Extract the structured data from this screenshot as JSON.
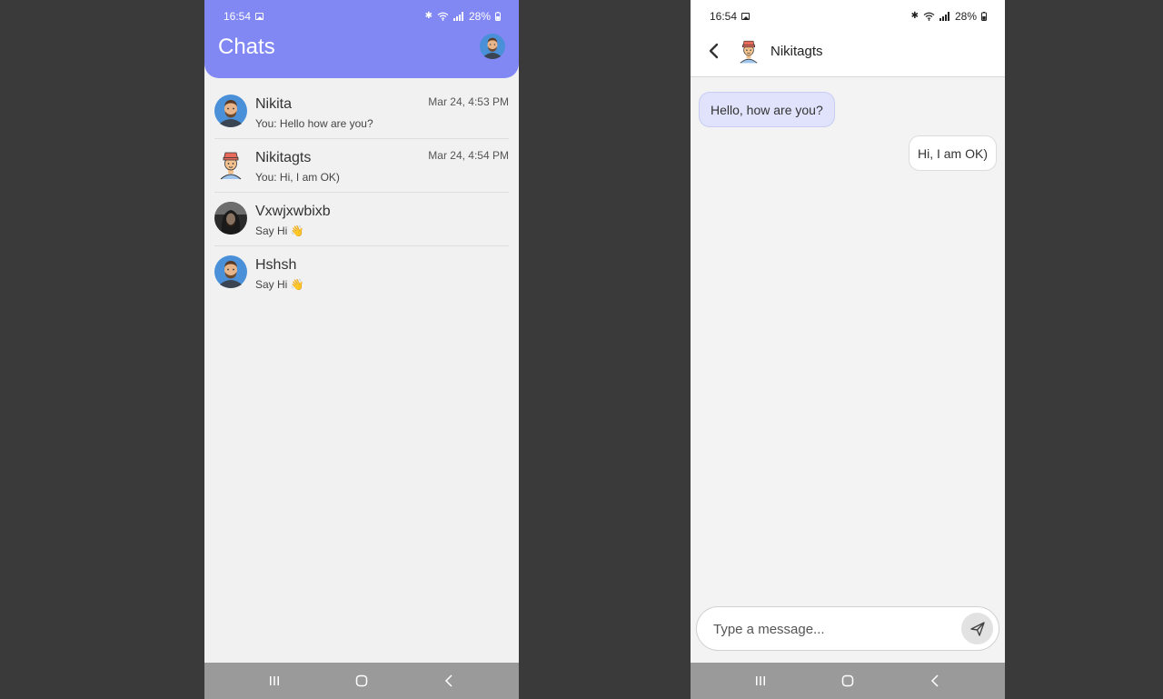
{
  "status_bar": {
    "time": "16:54",
    "battery": "28%"
  },
  "chats_screen": {
    "title": "Chats",
    "chats": [
      {
        "name": "Nikita",
        "preview": "You: Hello how are you?",
        "time": "Mar 24, 4:53 PM",
        "avatar": "man-avatar-icon"
      },
      {
        "name": "Nikitagts",
        "preview": "You: Hi, I am OK)",
        "time": "Mar 24, 4:54 PM",
        "avatar": "cap-avatar-icon"
      },
      {
        "name": "Vxwjxwbixb",
        "preview": "Say Hi 👋",
        "time": "",
        "avatar": "photo-avatar"
      },
      {
        "name": "Hshsh",
        "preview": "Say Hi 👋",
        "time": "",
        "avatar": "man-avatar-icon"
      }
    ]
  },
  "conversation": {
    "contact_name": "Nikitagts",
    "messages": [
      {
        "direction": "incoming",
        "text": "Hello, how are you?"
      },
      {
        "direction": "outgoing",
        "text": "Hi, I am OK)"
      }
    ],
    "composer": {
      "placeholder": "Type a message..."
    }
  },
  "colors": {
    "accent": "#8187f3",
    "incoming_bubble": "#e0e3fb",
    "nav_bar": "#9a9a9a"
  }
}
